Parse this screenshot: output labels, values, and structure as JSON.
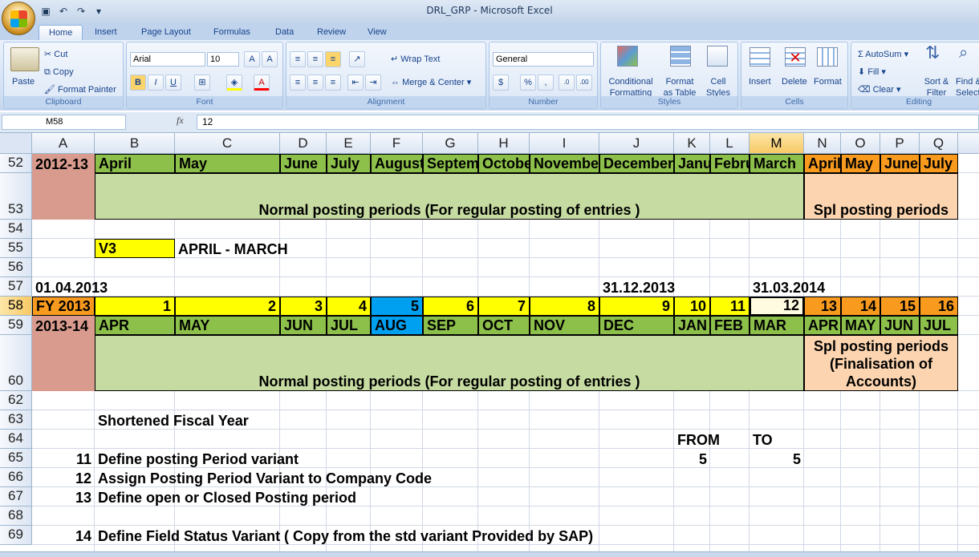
{
  "window": {
    "title": "DRL_GRP  -  Microsoft Excel"
  },
  "ribbon": {
    "tabs": [
      "Home",
      "Insert",
      "Page Layout",
      "Formulas",
      "Data",
      "Review",
      "View"
    ],
    "clipboard": {
      "paste": "Paste",
      "cut": "Cut",
      "copy": "Copy",
      "format_painter": "Format Painter",
      "label": "Clipboard"
    },
    "font": {
      "name": "Arial",
      "size": "10",
      "label": "Font"
    },
    "alignment": {
      "wrap": "Wrap Text",
      "merge": "Merge & Center",
      "label": "Alignment"
    },
    "number": {
      "format": "General",
      "currency": "$",
      "percent": "%",
      "comma": ",",
      "label": "Number"
    },
    "styles": {
      "conditional_1": "Conditional",
      "conditional_2": "Formatting",
      "table_1": "Format",
      "table_2": "as Table",
      "cell_1": "Cell",
      "cell_2": "Styles",
      "label": "Styles"
    },
    "cells": {
      "insert": "Insert",
      "delete": "Delete",
      "format": "Format",
      "label": "Cells"
    },
    "editing": {
      "autosum": "AutoSum",
      "fill": "Fill",
      "clear": "Clear",
      "sort_1": "Sort &",
      "sort_2": "Filter",
      "find_1": "Find &",
      "find_2": "Select",
      "label": "Editing"
    }
  },
  "formula_bar": {
    "name_box": "M58",
    "fx": "fx",
    "value": "12"
  },
  "columns": [
    "A",
    "B",
    "C",
    "D",
    "E",
    "F",
    "G",
    "H",
    "I",
    "J",
    "K",
    "L",
    "M",
    "N",
    "O",
    "P",
    "Q"
  ],
  "rows": [
    "52",
    "53",
    "54",
    "55",
    "56",
    "57",
    "58",
    "59",
    "60",
    "62",
    "63",
    "64",
    "65",
    "66",
    "67",
    "68",
    "69"
  ],
  "cells": {
    "r52": {
      "A": "2012-13",
      "B": "April",
      "C": "May",
      "D": "June",
      "E": "July",
      "F": "August",
      "G": "September",
      "H": "October",
      "I": "November",
      "J": "December",
      "K": "January",
      "L": "February",
      "M": "March",
      "N": "April",
      "O": "May",
      "P": "June",
      "Q": "July"
    },
    "r53": {
      "normal": "Normal posting periods (For regular posting of entries )",
      "spl": "Spl posting periods"
    },
    "r55": {
      "B": "V3",
      "C": "APRIL - MARCH"
    },
    "r57": {
      "A": "01.04.2013",
      "J": "31.12.2013",
      "M": "31.03.2014"
    },
    "r58": {
      "A": "FY 2013",
      "B": "1",
      "C": "2",
      "D": "3",
      "E": "4",
      "F": "5",
      "G": "6",
      "H": "7",
      "I": "8",
      "J": "9",
      "K": "10",
      "L": "11",
      "M": "12",
      "N": "13",
      "O": "14",
      "P": "15",
      "Q": "16"
    },
    "r59": {
      "A": "2013-14",
      "B": "APR",
      "C": "MAY",
      "D": "JUN",
      "E": "JUL",
      "F": "AUG",
      "G": "SEP",
      "H": "OCT",
      "I": "NOV",
      "J": "DEC",
      "K": "JAN",
      "L": "FEB",
      "M": "MAR",
      "N": "APR",
      "O": "MAY",
      "P": "JUN",
      "Q": "JUL"
    },
    "r60": {
      "normal": "Normal posting periods (For regular posting of entries )",
      "spl_1": "Spl posting periods",
      "spl_2": "(Finalisation of",
      "spl_3": "Accounts)"
    },
    "r63": {
      "B": "Shortened Fiscal Year"
    },
    "r64": {
      "K": "FROM",
      "M": "TO"
    },
    "r65": {
      "A": "11",
      "B": "Define posting Period variant",
      "K": "5",
      "M": "5"
    },
    "r66": {
      "A": "12",
      "B": "Assign Posting Period Variant to Company Code"
    },
    "r67": {
      "A": "13",
      "B": "Define open or Closed Posting period"
    },
    "r69": {
      "A": "14",
      "B": "Define Field Status Variant   ( Copy from the std variant Provided by SAP)"
    }
  },
  "colors": {
    "green": "#8dc04a",
    "lightgreen": "#c6dba1",
    "yellow": "#ffff00",
    "blue": "#00a0f0",
    "orange": "#f79a1e",
    "peach": "#fcd5b0",
    "salmon": "#d99b8e"
  }
}
